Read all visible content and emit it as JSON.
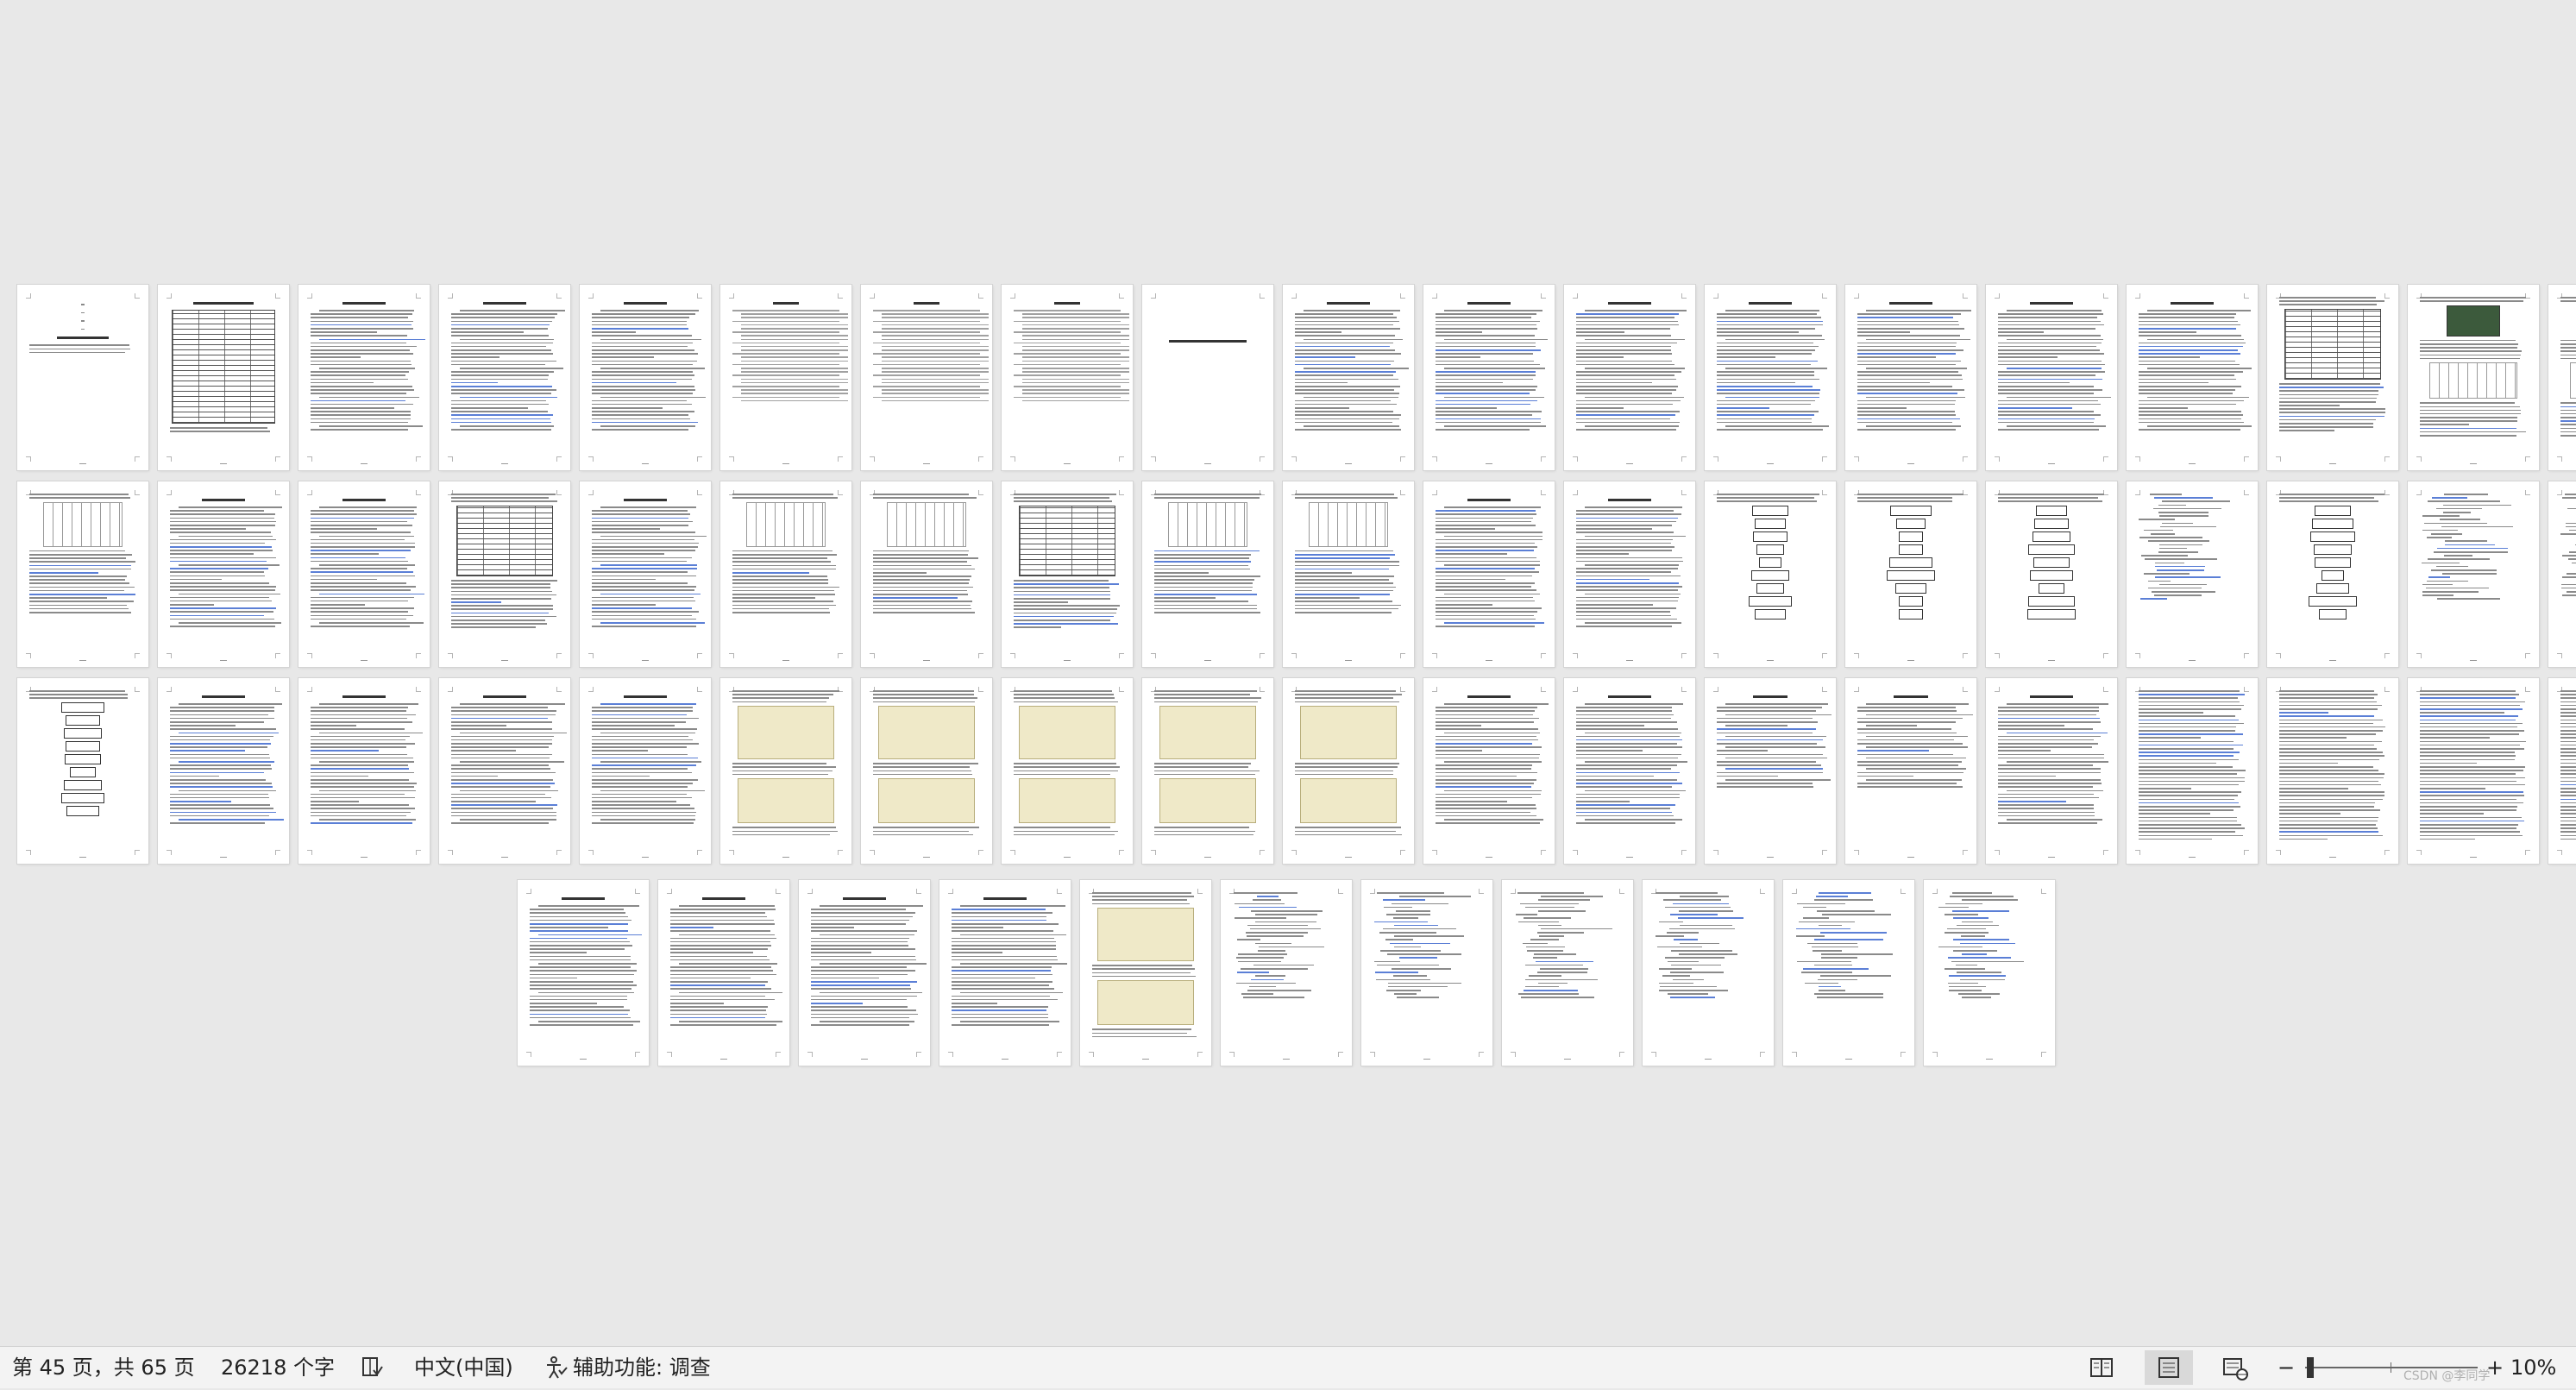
{
  "status_bar": {
    "page_info": "第 45 页，共 65 页",
    "word_count": "26218 个字",
    "language": "中文(中国)",
    "accessibility": "辅助功能: 调查",
    "zoom_out": "−",
    "zoom_in": "+",
    "zoom": "10%",
    "watermark": "CSDN @李同学"
  },
  "icons": {
    "proofing": "spellcheck-book-icon",
    "accessibility": "accessibility-person-icon",
    "read_mode": "read-mode-icon",
    "print_layout": "print-layout-icon",
    "web_layout": "web-layout-icon"
  },
  "document": {
    "total_pages": 65,
    "rows": [
      [
        "cover",
        "form",
        "text",
        "text",
        "text",
        "toc",
        "toc",
        "toc",
        "titlepage",
        "text",
        "text",
        "text",
        "text",
        "text",
        "text",
        "text",
        "table",
        "photo",
        "photo"
      ],
      [
        "diagram",
        "text",
        "text",
        "table",
        "text",
        "diagram",
        "diagram",
        "table",
        "diagram",
        "diagram",
        "text",
        "text",
        "flow",
        "flow",
        "flow",
        "code",
        "flow",
        "code",
        "code"
      ],
      [
        "flow",
        "text",
        "text",
        "text",
        "text",
        "circuit",
        "circuit",
        "circuit",
        "circuit",
        "circuit",
        "text",
        "text",
        "refs",
        "refs",
        "text",
        "dense",
        "dense",
        "dense",
        "dense"
      ],
      [
        "text",
        "text",
        "text",
        "text",
        "circuit",
        "code",
        "code",
        "code",
        "code",
        "code",
        "code"
      ]
    ]
  }
}
